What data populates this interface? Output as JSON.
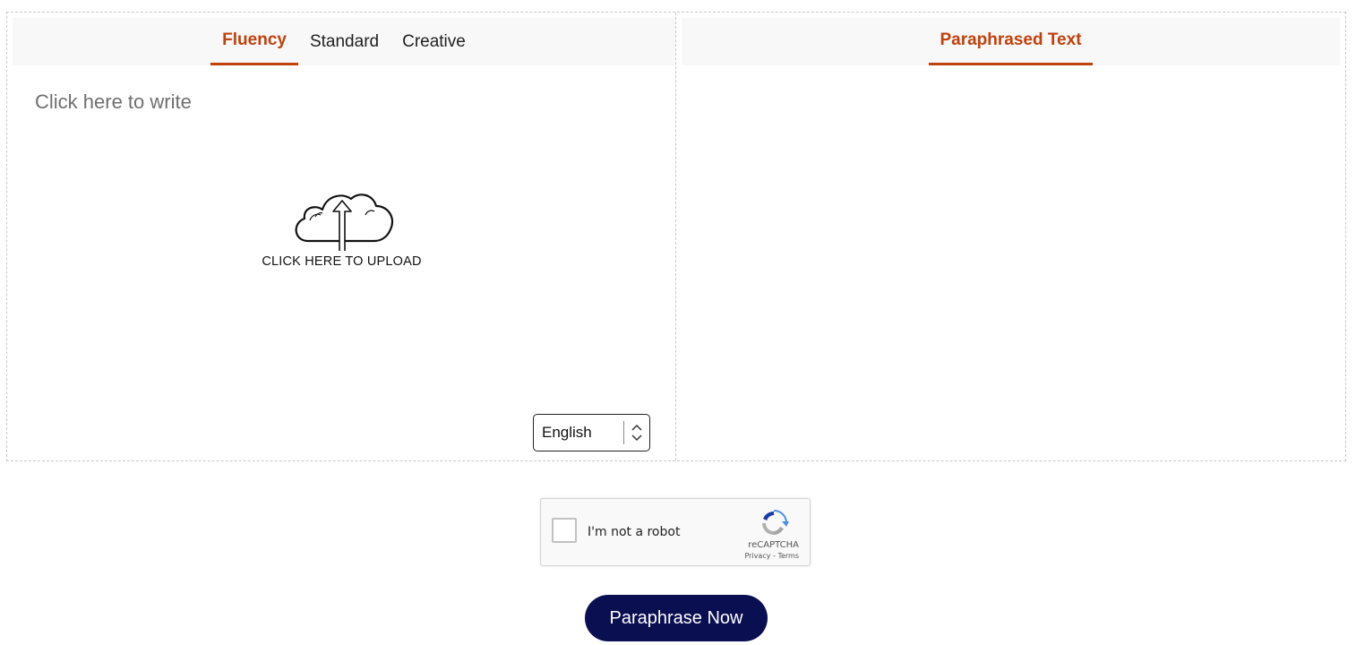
{
  "input_panel": {
    "tabs": [
      {
        "label": "Fluency",
        "active": true
      },
      {
        "label": "Standard",
        "active": false
      },
      {
        "label": "Creative",
        "active": false
      }
    ],
    "placeholder": "Click here to write",
    "upload_label": "CLICK HERE TO UPLOAD",
    "upload_icon": "cloud-upload-icon",
    "language": {
      "selected": "English",
      "icon": "up-down-chevron-icon"
    }
  },
  "output_panel": {
    "tab_label": "Paraphrased Text"
  },
  "captcha": {
    "label": "I'm not a robot",
    "brand": "reCAPTCHA",
    "privacy": "Privacy",
    "separator": " - ",
    "terms": "Terms",
    "icon": "recaptcha-logo-icon"
  },
  "submit_button": {
    "label": "Paraphrase Now"
  },
  "colors": {
    "accent": "#c0410c",
    "button": "#0a0f52",
    "tabbar_bg": "#f8f8f8"
  }
}
